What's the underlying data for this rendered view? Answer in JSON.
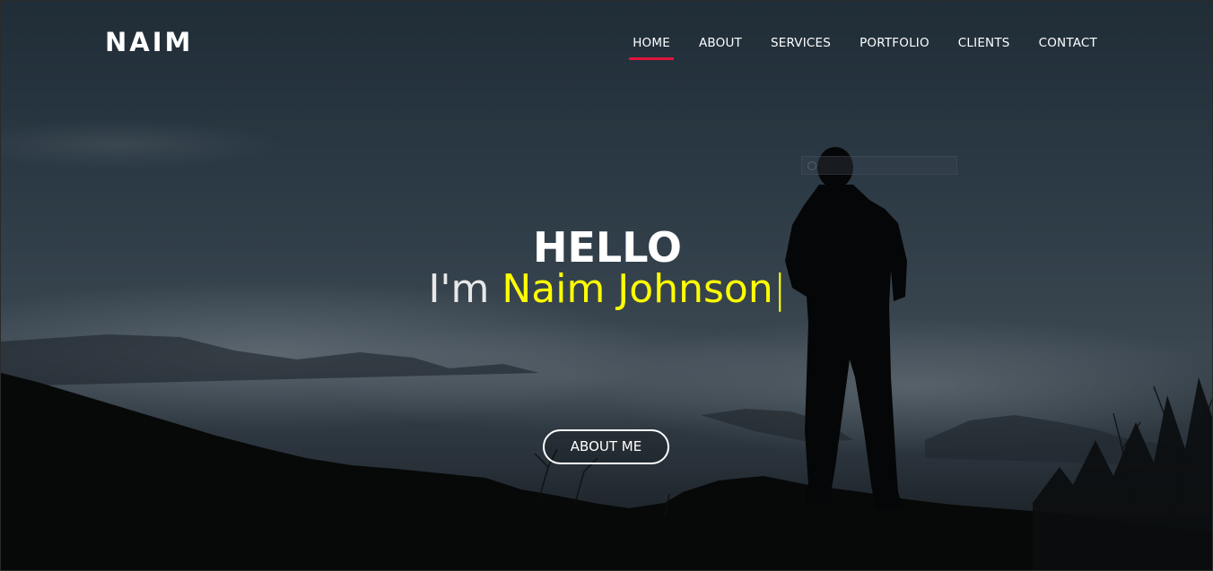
{
  "brand": {
    "logo_text": "NAIM"
  },
  "nav": {
    "items": [
      {
        "label": "HOME",
        "active": true
      },
      {
        "label": "ABOUT",
        "active": false
      },
      {
        "label": "SERVICES",
        "active": false
      },
      {
        "label": "PORTFOLIO",
        "active": false
      },
      {
        "label": "CLIENTS",
        "active": false
      },
      {
        "label": "CONTACT",
        "active": false
      }
    ]
  },
  "hero": {
    "greeting": "HELLO",
    "intro_prefix": "I'm ",
    "intro_name": "Naim Johnson",
    "cursor": "|",
    "cta_label": "ABOUT ME"
  },
  "colors": {
    "accent": "#e0143c",
    "name_highlight": "#ffff00",
    "text": "#ffffff"
  }
}
